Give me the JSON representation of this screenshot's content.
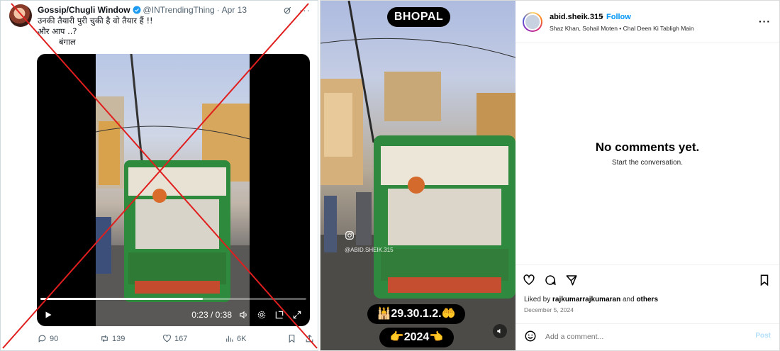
{
  "tweet": {
    "display_name": "Gossip/Chugli Window",
    "handle": "@INTrendingThing",
    "separator": "·",
    "date": "Apr 13",
    "text_line1": "उनकी तैयारी पुरी चुकी है वो तैयार हैं !!",
    "text_line2": "और आप ..?",
    "text_line3": "बंगाल",
    "video": {
      "time": "0:23 / 0:38",
      "progress_fraction": 0.61
    },
    "stats": {
      "replies": "90",
      "reposts": "139",
      "likes": "167",
      "views": "6K"
    },
    "colors": {
      "accent": "#1d9bf0",
      "cross": "#e01e1e"
    }
  },
  "instagram": {
    "reel": {
      "city_label": "BHOPAL",
      "date_label": "🕌29.30.1.2.🤲",
      "year_label": "👉2024👈",
      "watermark": "@ABID.SHEIK.315"
    },
    "header": {
      "username": "abid.sheik.315",
      "separator": "•",
      "follow_label": "Follow",
      "subtitle": "Shaz Khan, Sohail Moten • Chal Deen Ki Tabligh Main"
    },
    "comments": {
      "empty_title": "No comments yet.",
      "empty_subtitle": "Start the conversation."
    },
    "liked_by": {
      "prefix": "Liked by",
      "user": "rajkumarrajkumaran",
      "middle": "and",
      "others": "others"
    },
    "post_date": "December 5, 2024",
    "add_comment_placeholder": "Add a comment...",
    "post_label": "Post",
    "colors": {
      "follow": "#0095f6",
      "post_disabled": "#b2dffc"
    }
  }
}
